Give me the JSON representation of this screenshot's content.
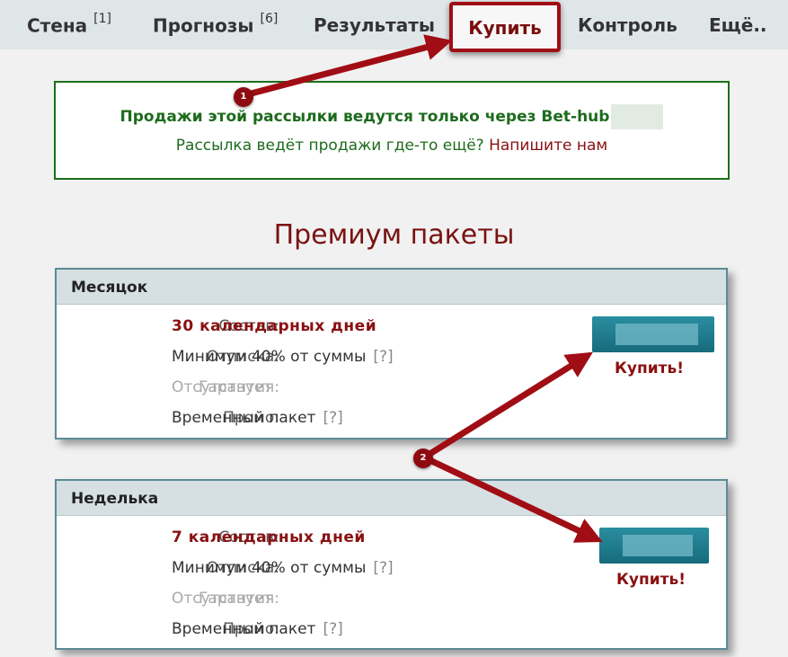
{
  "nav": {
    "items": [
      {
        "label": "Стена",
        "badge": "[1]"
      },
      {
        "label": "Прогнозы",
        "badge": "[6]"
      },
      {
        "label": "Результаты"
      },
      {
        "label": "Купить",
        "active": true
      },
      {
        "label": "Контроль"
      },
      {
        "label": "Ещё.."
      }
    ]
  },
  "notice": {
    "line1": "Продажи этой рассылки ведутся только через Bet-hub",
    "line2_text": "Рассылка ведёт продажи где-то ещё?",
    "line2_link": "Напишите нам"
  },
  "heading": "Премиум пакеты",
  "packages": [
    {
      "title": "Месяцок",
      "rows": [
        {
          "label": "Состав:",
          "value": "30 календарных дней"
        },
        {
          "label": "Отписка:",
          "value": "Минимум 40% от суммы",
          "help": "[?]"
        },
        {
          "label": "Гарантия:",
          "value": "Отсутствует"
        },
        {
          "label": "Промо:",
          "value": "Временный пакет",
          "help": "[?]"
        }
      ],
      "buy_label": "Купить!"
    },
    {
      "title": "Неделька",
      "rows": [
        {
          "label": "Состав:",
          "value": "7 календарных дней"
        },
        {
          "label": "Отписка:",
          "value": "Минимум 40% от суммы",
          "help": "[?]"
        },
        {
          "label": "Гарантия:",
          "value": "Отсутствует"
        },
        {
          "label": "Промо:",
          "value": "Временный пакет",
          "help": "[?]"
        }
      ],
      "buy_label": "Купить!"
    }
  ],
  "annotations": {
    "marker1": "1",
    "marker2": "2"
  },
  "colors": {
    "accent": "#8a1010",
    "nav_bg": "#dfe6e8",
    "notice_green": "#1d6b1d",
    "card_border": "#5b8b96",
    "button": "#1a7d8f"
  }
}
